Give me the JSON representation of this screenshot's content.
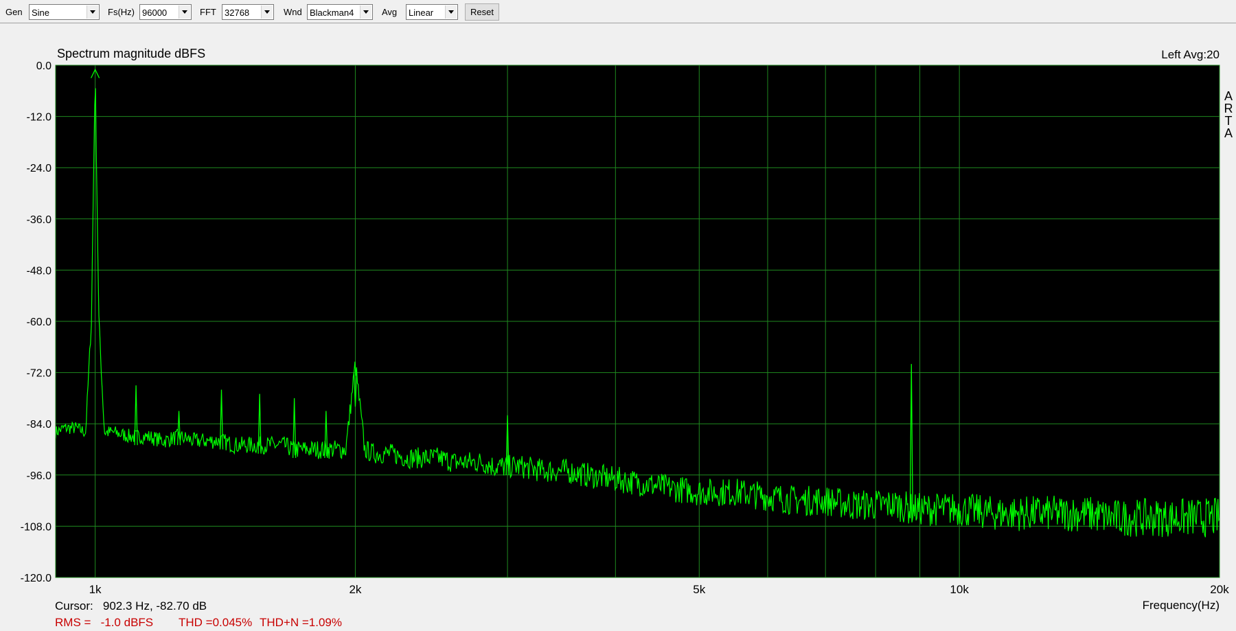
{
  "toolbar": {
    "gen": {
      "label": "Gen",
      "value": "Sine"
    },
    "fs": {
      "label": "Fs(Hz)",
      "value": "96000"
    },
    "fft": {
      "label": "FFT",
      "value": "32768"
    },
    "wnd": {
      "label": "Wnd",
      "value": "Blackman4"
    },
    "avg": {
      "label": "Avg",
      "value": "Linear"
    },
    "reset_label": "Reset"
  },
  "plot": {
    "title": "Spectrum magnitude dBFS",
    "channel_info": "Left  Avg:20",
    "side_tag": [
      "A",
      "R",
      "T",
      "A"
    ],
    "x_axis_label": "Frequency(Hz)"
  },
  "status": {
    "cursor": "Cursor:   902.3 Hz, -82.70 dB",
    "rms": "RMS =   -1.0 dBFS",
    "thd": "THD =0.045%",
    "thdn": "THD+N =1.09%"
  },
  "colors": {
    "plot_bg": "#000000",
    "grid": "#1f8a1f",
    "trace": "#00ff00",
    "status_red": "#c80000"
  },
  "chart_data": {
    "type": "line",
    "title": "Spectrum magnitude dBFS",
    "xlabel": "Frequency(Hz)",
    "ylabel": "",
    "x_scale": "log",
    "xlim": [
      900,
      20000
    ],
    "ylim": [
      -120,
      0
    ],
    "yticks": [
      0,
      -12,
      -24,
      -36,
      -48,
      -60,
      -72,
      -84,
      -96,
      -108,
      -120
    ],
    "ytick_labels": [
      "0.0",
      "-12.0",
      "-24.0",
      "-36.0",
      "-48.0",
      "-60.0",
      "-72.0",
      "-84.0",
      "-96.0",
      "-108.0",
      "-120.0"
    ],
    "xticks": [
      1000,
      2000,
      5000,
      10000,
      20000
    ],
    "xtick_labels": [
      "1k",
      "2k",
      "5k",
      "10k",
      "20k"
    ],
    "x_gridlines": [
      1000,
      2000,
      3000,
      4000,
      5000,
      6000,
      7000,
      8000,
      9000,
      10000,
      20000
    ],
    "grid": true,
    "series": [
      {
        "x": [
          900,
          920,
          950,
          975,
          990,
          1000,
          1010,
          1025,
          1050,
          1100,
          1150,
          1200,
          1250,
          1300,
          1350,
          1400,
          1450,
          1500,
          1550,
          1600,
          1650,
          1700,
          1750,
          1800,
          1850,
          1900,
          1950,
          2000,
          2050,
          2100,
          2200,
          2300,
          2400,
          2500,
          2600,
          2700,
          2800,
          2900,
          3000,
          3100,
          3300,
          3500,
          3700,
          4000,
          4300,
          4600,
          5000,
          5500,
          6000,
          6500,
          7000,
          7500,
          8000,
          8500,
          8800,
          9000,
          9500,
          10000,
          11000,
          12000,
          13000,
          14000,
          15000,
          16000,
          17000,
          18000,
          19000,
          20000
        ],
        "y": [
          -86,
          -85,
          -85,
          -86,
          -60,
          -1,
          -60,
          -86,
          -86,
          -87,
          -87,
          -88,
          -87,
          -88,
          -88,
          -88,
          -89,
          -89,
          -89,
          -89,
          -89,
          -90,
          -90,
          -90,
          -90,
          -90,
          -90,
          -70,
          -90,
          -91,
          -91,
          -92,
          -92,
          -92,
          -93,
          -93,
          -93,
          -94,
          -94,
          -94,
          -95,
          -95,
          -96,
          -97,
          -98,
          -99,
          -100,
          -100,
          -101,
          -102,
          -102,
          -103,
          -103,
          -103,
          -104,
          -104,
          -104,
          -104,
          -105,
          -105,
          -105,
          -105,
          -106,
          -106,
          -106,
          -106,
          -106,
          -106
        ]
      }
    ],
    "harmonics": [
      {
        "x": 1000,
        "y": -1
      },
      {
        "x": 1115,
        "y": -75
      },
      {
        "x": 1250,
        "y": -81
      },
      {
        "x": 1400,
        "y": -76
      },
      {
        "x": 1550,
        "y": -77
      },
      {
        "x": 1700,
        "y": -78
      },
      {
        "x": 1850,
        "y": -81
      },
      {
        "x": 2000,
        "y": -80
      },
      {
        "x": 3000,
        "y": -82
      },
      {
        "x": 8800,
        "y": -70
      }
    ]
  }
}
